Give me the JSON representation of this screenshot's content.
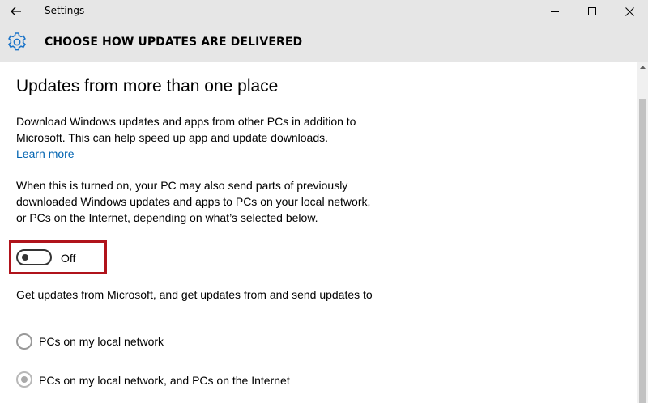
{
  "titlebar": {
    "app_title": "Settings",
    "back_icon": "back-arrow-icon",
    "minimize_icon": "minimize-icon",
    "maximize_icon": "maximize-icon",
    "close_icon": "close-icon"
  },
  "header": {
    "icon": "gear-icon",
    "title": "CHOOSE HOW UPDATES ARE DELIVERED"
  },
  "content": {
    "section_title": "Updates from more than one place",
    "paragraph1": "Download Windows updates and apps from other PCs in addition to Microsoft. This can help speed up app and update downloads.",
    "learn_more": "Learn more",
    "paragraph2": "When this is turned on, your PC may also send parts of previously downloaded Windows updates and apps to PCs on your local network, or PCs on the Internet, depending on what’s selected below.",
    "toggle": {
      "state": "Off",
      "on": false
    },
    "paragraph3": "Get updates from Microsoft, and get updates from and send updates to",
    "options": [
      {
        "label": "PCs on my local network",
        "selected": false
      },
      {
        "label": "PCs on my local network, and PCs on the Internet",
        "selected": true
      }
    ]
  },
  "colors": {
    "chrome": "#e6e6e6",
    "link": "#0063b1",
    "highlight": "#b0131b",
    "icon_blue": "#1a73c8"
  }
}
